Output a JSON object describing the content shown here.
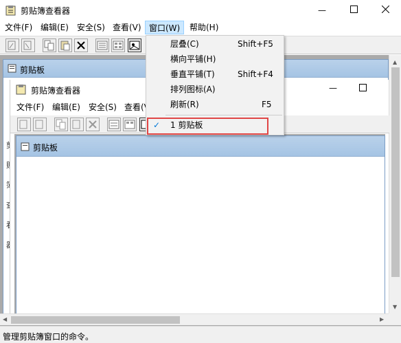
{
  "outer_window": {
    "title": "剪贴簿查看器",
    "minimize_glyph": "—",
    "maximize_glyph": "☐",
    "close_glyph": "✕",
    "menu": [
      "文件(F)",
      "编辑(E)",
      "安全(S)",
      "查看(V)",
      "窗口(W)",
      "帮助(H)"
    ]
  },
  "mdi_child": {
    "title": "剪贴板"
  },
  "inner_window": {
    "title": "剪贴簿查看器",
    "menu": [
      "文件(F)",
      "编辑(E)",
      "安全(S)",
      "查看(V)"
    ],
    "child_title": "剪贴板"
  },
  "window_menu": {
    "items": [
      {
        "label": "层叠(C)",
        "shortcut": "Shift+F5"
      },
      {
        "label": "横向平铺(H)",
        "shortcut": ""
      },
      {
        "label": "垂直平铺(T)",
        "shortcut": "Shift+F4"
      },
      {
        "label": "排列图标(A)",
        "shortcut": ""
      },
      {
        "label": "刷新(R)",
        "shortcut": "F5"
      }
    ],
    "checked_item": {
      "label": "1 剪贴板",
      "check_glyph": "✓"
    }
  },
  "left_edge_chars": [
    "剪",
    "贴",
    "簿",
    "查",
    "看",
    "器"
  ],
  "status_bar": {
    "text": "管理剪贴簿窗口的命令。"
  },
  "colors": {
    "accent": "#0078d7",
    "highlight_box": "#e04545",
    "mdi_bar": "#b9d1ea",
    "menu_active": "#cce8ff"
  }
}
